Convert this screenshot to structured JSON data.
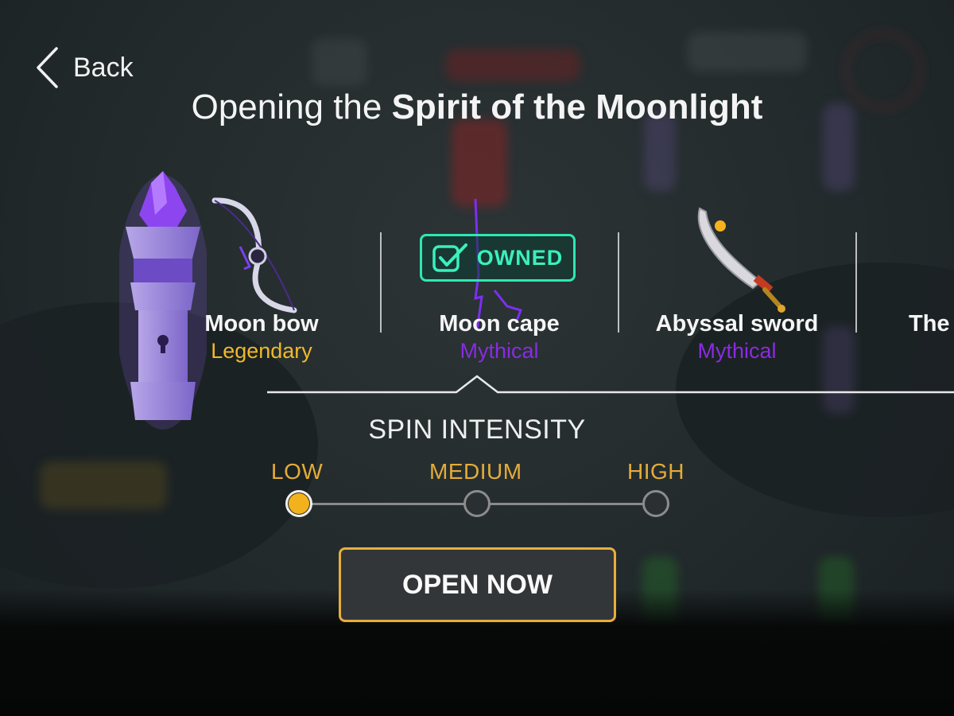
{
  "header": {
    "back_label": "Back",
    "title_prefix": "Opening the ",
    "title_chest": "Spirit of the Moonlight"
  },
  "items": [
    {
      "name": "Moon bow",
      "rarity": "Legendary",
      "rarity_color": "#f0b92b",
      "icon": "bow-icon"
    },
    {
      "name": "Moon cape",
      "rarity": "Mythical",
      "rarity_color": "#8a2be2",
      "icon": "cape-icon",
      "badge": "OWNED"
    },
    {
      "name": "Abyssal sword",
      "rarity": "Mythical",
      "rarity_color": "#8a2be2",
      "icon": "sword-icon"
    },
    {
      "name": "The"
    }
  ],
  "spin": {
    "title": "SPIN INTENSITY",
    "levels": [
      "LOW",
      "MEDIUM",
      "HIGH"
    ],
    "selected": "LOW"
  },
  "action": {
    "open_label": "OPEN NOW"
  },
  "colors": {
    "accent_gold": "#e7ae3c",
    "owned_teal": "#2ee8b0",
    "mythical_purple": "#8a2be2",
    "legendary_gold": "#f0b92b"
  }
}
